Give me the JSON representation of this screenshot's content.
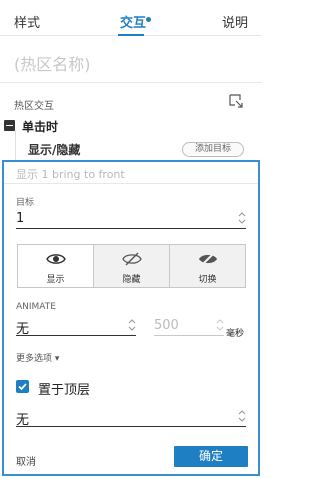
{
  "tabs": [
    {
      "label": "样式"
    },
    {
      "label": "交互"
    },
    {
      "label": "说明"
    }
  ],
  "name_placeholder": "(热区名称)",
  "section": {
    "title": "热区交互",
    "icon": "expand-corner-icon"
  },
  "event": {
    "label": "单击时"
  },
  "case": {
    "label": "显示/隐藏",
    "add_target": "添加目标"
  },
  "panel": {
    "header": "显示 1  bring to front",
    "target": {
      "label": "目标",
      "value": "1"
    },
    "visibility_options": [
      {
        "label": "显示",
        "icon": "eye-icon",
        "selected": true
      },
      {
        "label": "隐藏",
        "icon": "eye-slash-icon",
        "selected": false
      },
      {
        "label": "切换",
        "icon": "eye-toggle-icon",
        "selected": false
      }
    ],
    "animate": {
      "label": "ANIMATE",
      "value": "无",
      "duration": "500",
      "unit": "毫秒"
    },
    "more_options": "更多选项 ▾",
    "bring_front": {
      "label": "置于顶层",
      "checked": true
    },
    "bring_front_value": "无",
    "cancel": "取消",
    "ok": "确定"
  },
  "colors": {
    "accent": "#1f7fc3",
    "panel_border": "#3a8fd0"
  }
}
